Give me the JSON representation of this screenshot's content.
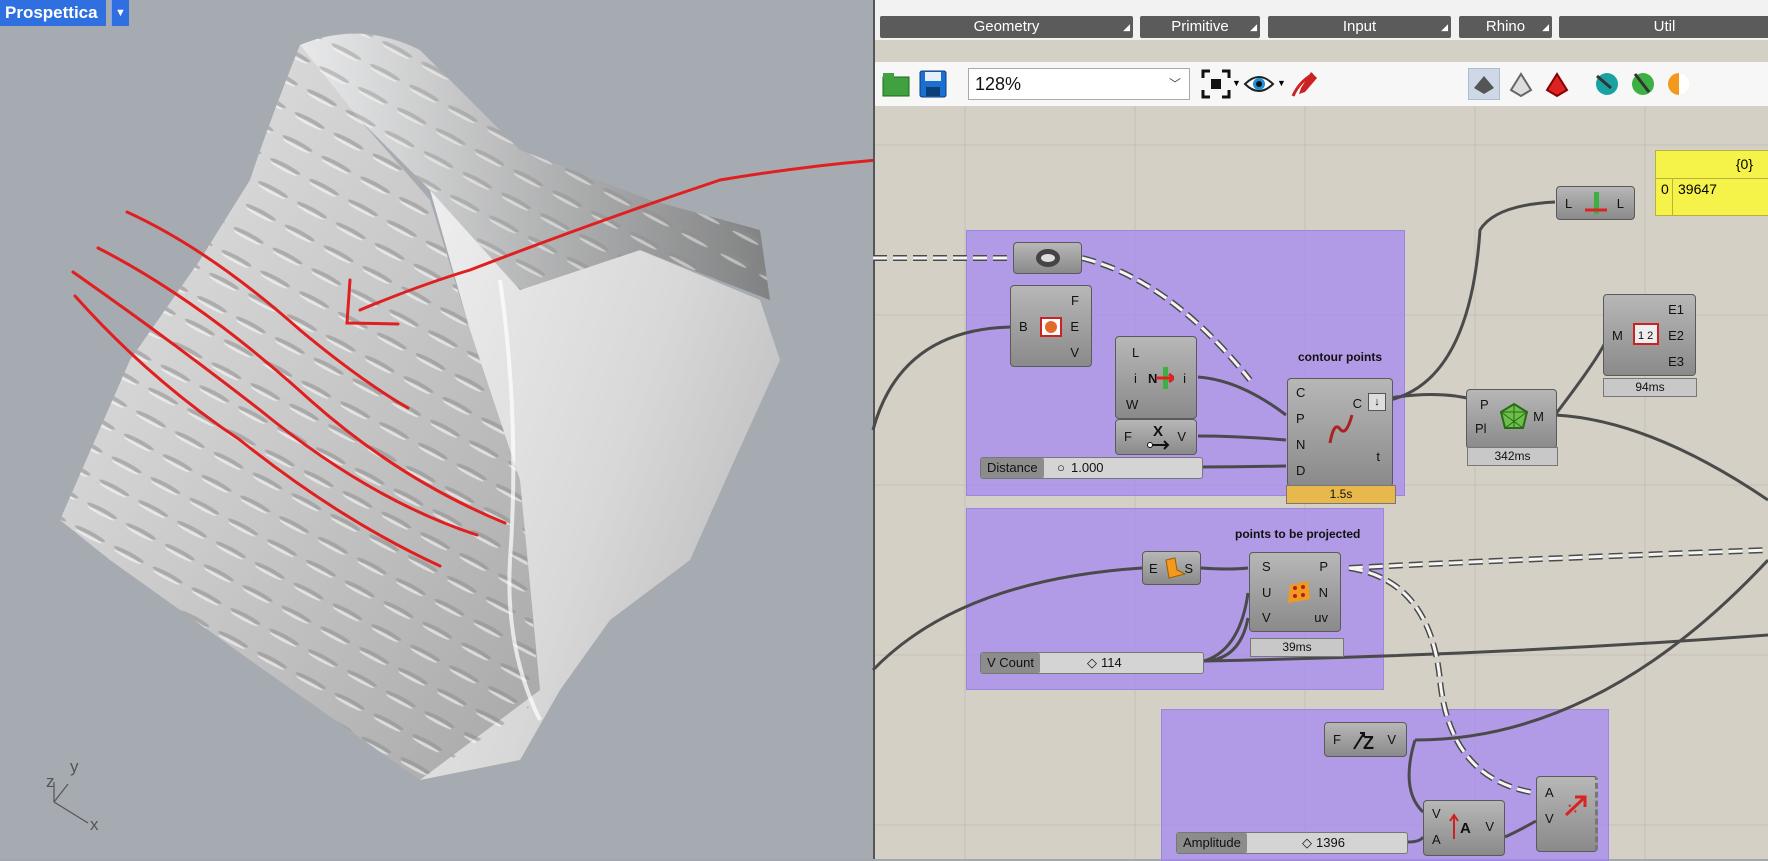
{
  "viewport": {
    "label": "Prospettica",
    "axes": {
      "z": "z",
      "y": "y",
      "x": "x"
    }
  },
  "tabs": [
    {
      "label": "Geometry"
    },
    {
      "label": "Primitive"
    },
    {
      "label": "Input"
    },
    {
      "label": "Rhino"
    },
    {
      "label": "Util"
    }
  ],
  "toolbar": {
    "zoom": "128%",
    "icons": [
      "open-file-icon",
      "save-icon",
      "zoom-extents-icon",
      "preview-eye-icon",
      "sketch-pen-icon",
      "preview-shaded-icon",
      "preview-wire-icon",
      "preview-selected-icon",
      "render-icon",
      "color-icon",
      "halfmoon-icon"
    ]
  },
  "groups": {
    "contour": {
      "title": "contour points"
    },
    "projected": {
      "title": "points to be projected"
    }
  },
  "components": {
    "brep_edges": {
      "in": "B",
      "out": [
        "F",
        "E",
        "V"
      ]
    },
    "list_item": {
      "in": [
        "L",
        "i",
        "W"
      ],
      "mid": "N",
      "out": "i"
    },
    "function": {
      "in": "F",
      "out": "V"
    },
    "contour": {
      "in": [
        "C",
        "P",
        "N",
        "D"
      ],
      "out": [
        "C",
        "t"
      ],
      "timer": "1.5s"
    },
    "surface_points": {
      "in": [
        "S",
        "U",
        "V"
      ],
      "out": [
        "P",
        "N",
        "uv"
      ],
      "timer": "39ms"
    },
    "edge_srf": {
      "in": "E",
      "out": "S"
    },
    "list_length": {
      "in": "L",
      "out": "L"
    },
    "mesh_from_points": {
      "in": [
        "P",
        "Pl"
      ],
      "out": "M",
      "timer": "342ms"
    },
    "mesh_edges": {
      "in": "M",
      "out": [
        "E1",
        "E2",
        "E3"
      ],
      "timer": "94ms"
    },
    "unit_z": {
      "in": "F",
      "out": "V"
    },
    "amplitude": {
      "in": [
        "V",
        "A"
      ],
      "out": "V"
    },
    "move": {
      "in": [
        "A",
        "V"
      ]
    }
  },
  "sliders": {
    "distance": {
      "name": "Distance",
      "value": "1.000"
    },
    "vcount": {
      "name": "V Count",
      "value": "114"
    },
    "amplitude": {
      "name": "Amplitude",
      "value": "1396"
    }
  },
  "panel": {
    "path": "{0}",
    "index": "0",
    "value": "39647"
  }
}
